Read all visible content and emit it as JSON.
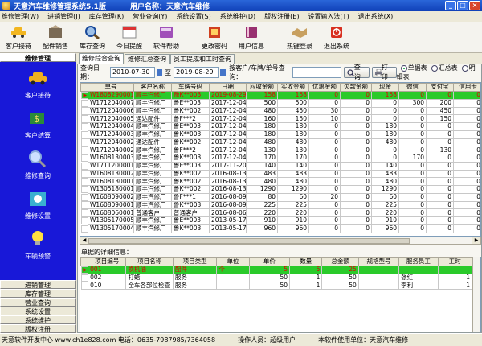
{
  "window": {
    "title": "天意汽车维修管理系统5.1版",
    "owner": "用户名称：天意汽车维修",
    "min": "_",
    "max": "□",
    "close": "×"
  },
  "menu": [
    "维修管理(W)",
    "进销管理(J)",
    "库存管理(K)",
    "营业查询(Y)",
    "系统设置(S)",
    "系统维护(D)",
    "版权注册(E)",
    "设置输入法(T)",
    "退出系统(X)"
  ],
  "toolbar": [
    {
      "label": "客户接待",
      "icon": "car-icon",
      "color": "#f2b620"
    },
    {
      "label": "配件销售",
      "icon": "parts-icon",
      "color": "#7a6a55"
    },
    {
      "label": "库存查询",
      "icon": "magnifier-icon",
      "color": "#9fc1e8"
    },
    {
      "label": "今日提醒",
      "icon": "reminder-icon",
      "color": "#e9e7dd"
    },
    {
      "label": "软件帮助",
      "icon": "help-book-icon",
      "color": "#a050b8"
    },
    {
      "label": "更改密码",
      "icon": "password-icon",
      "color": "#d04020"
    },
    {
      "label": "用户信息",
      "icon": "user-book-icon",
      "color": "#983070"
    },
    {
      "label": "热键登录",
      "icon": "handshake-icon",
      "color": "#c8a060"
    },
    {
      "label": "退出系统",
      "icon": "exit-icon",
      "color": "#d83020"
    }
  ],
  "sidebar": {
    "top_header": "维修管理",
    "items": [
      {
        "label": "客户接待",
        "icon": "car-icon"
      },
      {
        "label": "客户结算",
        "icon": "money-icon"
      },
      {
        "label": "维修查询",
        "icon": "query-icon"
      },
      {
        "label": "维修设置",
        "icon": "gear-icon"
      },
      {
        "label": "车辆预警",
        "icon": "bulb-icon"
      }
    ],
    "bottom_headers": [
      "进销管理",
      "库存管理",
      "营业查询",
      "系统设置",
      "系统维护",
      "版权注册"
    ]
  },
  "tabs": [
    "维修综合查询",
    "维修汇总查询",
    "员工提成和工时查询"
  ],
  "filter": {
    "date_label": "查询日期：",
    "date_from": "2010-07-30",
    "to": "至",
    "date_to": "2019-08-29",
    "keyword_label": "按客户/车牌/单号查询：",
    "keyword": "",
    "query_btn": "查询",
    "print_btn": "打印",
    "radios": [
      {
        "label": "单据表",
        "on": true
      },
      {
        "label": "汇总表",
        "on": false
      },
      {
        "label": "明细表",
        "on": false
      }
    ]
  },
  "main_table": {
    "columns": [
      "",
      "单号",
      "客户名称",
      "车牌号码",
      "日期",
      "应收金额",
      "实收金额",
      "优惠金额",
      "欠款金额",
      "现金",
      "微信",
      "支付宝",
      "信用卡"
    ],
    "rows": [
      {
        "sel": true,
        "cells": [
          "▶",
          "W1808290001",
          "顺丰汽修厂",
          "豫K**003",
          "2019-08-29",
          "158",
          "158",
          "0",
          "0",
          "158",
          "0",
          "0",
          "0"
        ]
      },
      {
        "sel": false,
        "cells": [
          "",
          "W1712040007",
          "顺丰汽修厂",
          "鲁E**003",
          "2017-12-04",
          "500",
          "500",
          "0",
          "0",
          "0",
          "300",
          "200",
          "0"
        ]
      },
      {
        "sel": false,
        "cells": [
          "",
          "W1712040006",
          "顺丰汽修厂",
          "鲁K**002",
          "2017-12-04",
          "480",
          "450",
          "30",
          "0",
          "0",
          "0",
          "450",
          "0"
        ]
      },
      {
        "sel": false,
        "cells": [
          "",
          "W1712040005",
          "通达配件",
          "鲁F***2",
          "2017-12-04",
          "160",
          "150",
          "10",
          "0",
          "0",
          "0",
          "150",
          "0"
        ]
      },
      {
        "sel": false,
        "cells": [
          "",
          "W1712040004",
          "顺丰汽修厂",
          "鲁E**003",
          "2017-12-04",
          "180",
          "180",
          "0",
          "0",
          "180",
          "0",
          "0",
          "0"
        ]
      },
      {
        "sel": false,
        "cells": [
          "",
          "W1712040003",
          "顺丰汽修厂",
          "鲁K**003",
          "2017-12-04",
          "180",
          "180",
          "0",
          "0",
          "180",
          "0",
          "0",
          "0"
        ]
      },
      {
        "sel": false,
        "cells": [
          "",
          "W1712040002",
          "通达配件",
          "鲁K**002",
          "2017-12-04",
          "480",
          "480",
          "0",
          "0",
          "480",
          "0",
          "0",
          "0"
        ]
      },
      {
        "sel": false,
        "cells": [
          "",
          "W1712040002",
          "顺丰汽修厂",
          "鲁F***2",
          "2017-12-04",
          "130",
          "130",
          "0",
          "0",
          "0",
          "0",
          "130",
          "0"
        ]
      },
      {
        "sel": false,
        "cells": [
          "",
          "W1608130003",
          "顺丰汽修厂",
          "鲁K**003",
          "2017-12-04",
          "170",
          "170",
          "0",
          "0",
          "0",
          "170",
          "0",
          "0"
        ]
      },
      {
        "sel": false,
        "cells": [
          "",
          "W1711200001",
          "顺丰汽修厂",
          "鲁E**003",
          "2017-11-20",
          "140",
          "140",
          "0",
          "0",
          "140",
          "0",
          "0",
          "0"
        ]
      },
      {
        "sel": false,
        "cells": [
          "",
          "W1608130002",
          "顺丰汽修厂",
          "鲁K**002",
          "2016-08-13",
          "483",
          "483",
          "0",
          "0",
          "483",
          "0",
          "0",
          "0"
        ]
      },
      {
        "sel": false,
        "cells": [
          "",
          "W1608130001",
          "顺丰汽修厂",
          "鲁K**002",
          "2016-08-13",
          "480",
          "480",
          "0",
          "0",
          "480",
          "0",
          "0",
          "0"
        ]
      },
      {
        "sel": false,
        "cells": [
          "",
          "W1305180001",
          "顺丰汽修厂",
          "鲁K**002",
          "2016-08-13",
          "1290",
          "1290",
          "0",
          "0",
          "1290",
          "0",
          "0",
          "0"
        ]
      },
      {
        "sel": false,
        "cells": [
          "",
          "W1608090002",
          "顺丰汽修厂",
          "鲁F***1",
          "2016-08-09",
          "80",
          "60",
          "20",
          "0",
          "60",
          "0",
          "0",
          "0"
        ]
      },
      {
        "sel": false,
        "cells": [
          "",
          "W1608090001",
          "顺丰汽修厂",
          "鲁K**003",
          "2016-08-09",
          "225",
          "225",
          "0",
          "0",
          "225",
          "0",
          "0",
          "0"
        ]
      },
      {
        "sel": false,
        "cells": [
          "",
          "W1608060001",
          "普通客户",
          "普通客户",
          "2016-08-06",
          "220",
          "220",
          "0",
          "0",
          "220",
          "0",
          "0",
          "0"
        ]
      },
      {
        "sel": false,
        "cells": [
          "",
          "W1305170005",
          "顺丰汽修厂",
          "鲁E**003",
          "2013-05-17",
          "910",
          "910",
          "0",
          "0",
          "910",
          "0",
          "0",
          "0"
        ]
      },
      {
        "sel": false,
        "cells": [
          "",
          "W1305170004",
          "顺丰汽修厂",
          "鲁K**003",
          "2013-05-17",
          "960",
          "960",
          "0",
          "0",
          "960",
          "0",
          "0",
          "0"
        ]
      }
    ]
  },
  "detail_label": "单据的详细信息：",
  "detail_table": {
    "columns": [
      "",
      "项目编号",
      "项目名称",
      "项目类型",
      "单位",
      "单价",
      "数量",
      "总金额",
      "规格型号",
      "服务员工",
      "工时"
    ],
    "rows": [
      {
        "sel": true,
        "cells": [
          "▶",
          "001",
          "换机油",
          "配件",
          "个",
          "5",
          "5",
          "25",
          "",
          "",
          ""
        ]
      },
      {
        "sel": false,
        "cells": [
          "",
          "002",
          "打蜡",
          "服务",
          "",
          "50",
          "1",
          "50",
          "",
          "张红",
          "1"
        ]
      },
      {
        "sel": false,
        "cells": [
          "",
          "010",
          "全车各部位检查",
          "服务",
          "",
          "50",
          "1",
          "50",
          "",
          "李利",
          "1"
        ]
      }
    ]
  },
  "status": {
    "dev": "天意软件开发中心 www.ch1e828.com 电话：0635-7987985/7364058",
    "operator": "操作人员：超级用户",
    "licensee": "本软件使用单位：天意汽车维修"
  }
}
